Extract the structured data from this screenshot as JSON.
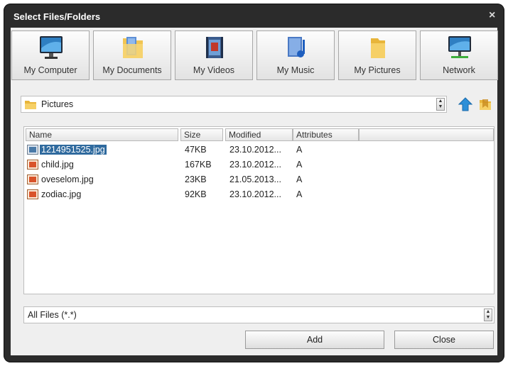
{
  "window": {
    "title": "Select Files/Folders",
    "close_glyph": "×"
  },
  "shortcuts": [
    {
      "label": "My Computer",
      "icon": "monitor-icon"
    },
    {
      "label": "My Documents",
      "icon": "documents-folder-icon"
    },
    {
      "label": "My Videos",
      "icon": "videos-icon"
    },
    {
      "label": "My Music",
      "icon": "music-icon"
    },
    {
      "label": "My Pictures",
      "icon": "pictures-folder-icon"
    },
    {
      "label": "Network",
      "icon": "network-icon"
    }
  ],
  "path": {
    "current": "Pictures"
  },
  "columns": {
    "name": "Name",
    "size": "Size",
    "modified": "Modified",
    "attributes": "Attributes"
  },
  "files": [
    {
      "name": "1214951525.jpg",
      "size": "47KB",
      "modified": "23.10.2012...",
      "attributes": "A",
      "selected": true
    },
    {
      "name": "child.jpg",
      "size": "167KB",
      "modified": "23.10.2012...",
      "attributes": "A",
      "selected": false
    },
    {
      "name": "oveselom.jpg",
      "size": "23KB",
      "modified": "21.05.2013...",
      "attributes": "A",
      "selected": false
    },
    {
      "name": "zodiac.jpg",
      "size": "92KB",
      "modified": "23.10.2012...",
      "attributes": "A",
      "selected": false
    }
  ],
  "filter": {
    "value": "All Files (*.*)"
  },
  "buttons": {
    "add": "Add",
    "close": "Close"
  },
  "colors": {
    "window_bg": "#2b2b2b",
    "selection": "#2f6a9e",
    "folder_yellow": "#f1c553",
    "up_arrow": "#2c8fd8"
  }
}
